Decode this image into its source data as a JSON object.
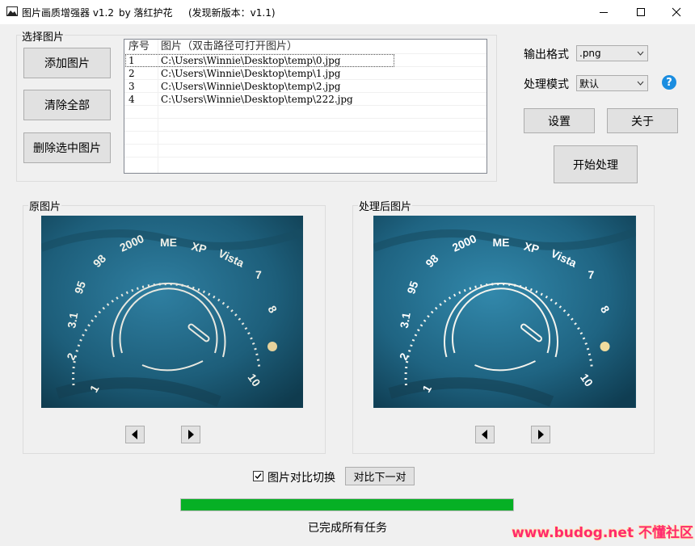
{
  "window": {
    "title": "图片画质增强器 v1.2",
    "author": "by 落红护花",
    "update_notice": "(发现新版本：v1.1)",
    "minimize_icon": "minimize-icon",
    "maximize_icon": "maximize-icon",
    "close_icon": "close-icon"
  },
  "select_group": {
    "label": "选择图片",
    "add_button": "添加图片",
    "clear_button": "清除全部",
    "delete_button": "删除选中图片"
  },
  "file_list": {
    "columns": [
      "序号",
      "图片（双击路径可打开图片）"
    ],
    "rows": [
      {
        "index": "1",
        "path": "C:\\Users\\Winnie\\Desktop\\temp\\0.jpg"
      },
      {
        "index": "2",
        "path": "C:\\Users\\Winnie\\Desktop\\temp\\1.jpg"
      },
      {
        "index": "3",
        "path": "C:\\Users\\Winnie\\Desktop\\temp\\2.jpg"
      },
      {
        "index": "4",
        "path": "C:\\Users\\Winnie\\Desktop\\temp\\222.jpg"
      }
    ]
  },
  "options": {
    "output_format_label": "输出格式",
    "output_format_value": ".png",
    "mode_label": "处理模式",
    "mode_value": "默认",
    "help_icon": "help-icon",
    "help_glyph": "?",
    "settings_button": "设置",
    "about_button": "关于",
    "start_button": "开始处理"
  },
  "preview": {
    "original_label": "原图片",
    "processed_label": "处理后图片",
    "dial_labels": [
      "1",
      "2",
      "3.1",
      "95",
      "98",
      "2000",
      "ME",
      "XP",
      "Vista",
      "7",
      "8",
      "10"
    ],
    "prev_icon": "triangle-left-icon",
    "next_icon": "triangle-right-icon"
  },
  "compare": {
    "checkbox_checked": true,
    "checkbox_label": "图片对比切换",
    "next_pair_button": "对比下一对"
  },
  "progress": {
    "value_percent": 100,
    "color": "#06b025",
    "status_text": "已完成所有任务"
  },
  "watermark": {
    "text": "www.budog.net 不懂社区"
  }
}
